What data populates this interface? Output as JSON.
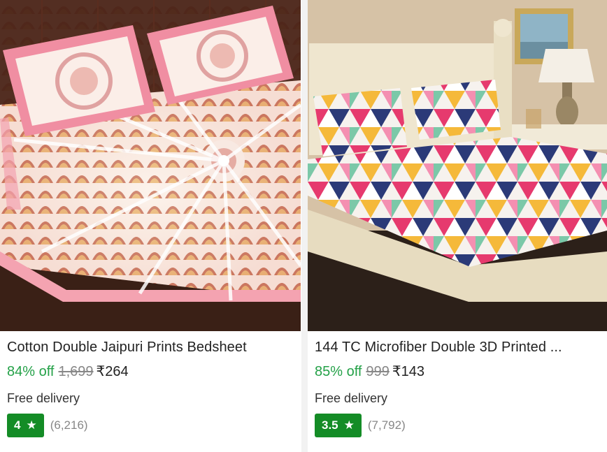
{
  "products": [
    {
      "title": "Cotton Double Jaipuri Prints Bedsheet",
      "discount": "84% off",
      "mrp": "1,699",
      "price": "₹264",
      "delivery": "Free delivery",
      "rating": "4",
      "rating_count": "(6,216)",
      "image_icon": "mandala-bedsheet-image"
    },
    {
      "title": "144 TC Microfiber Double 3D Printed ...",
      "discount": "85% off",
      "mrp": "999",
      "price": "₹143",
      "delivery": "Free delivery",
      "rating": "3.5",
      "rating_count": "(7,792)",
      "image_icon": "geometric-bedsheet-image"
    }
  ],
  "colors": {
    "discount": "#24a148",
    "rating_badge": "#148c26",
    "mrp": "#878787"
  },
  "icons": {
    "star": "★"
  }
}
